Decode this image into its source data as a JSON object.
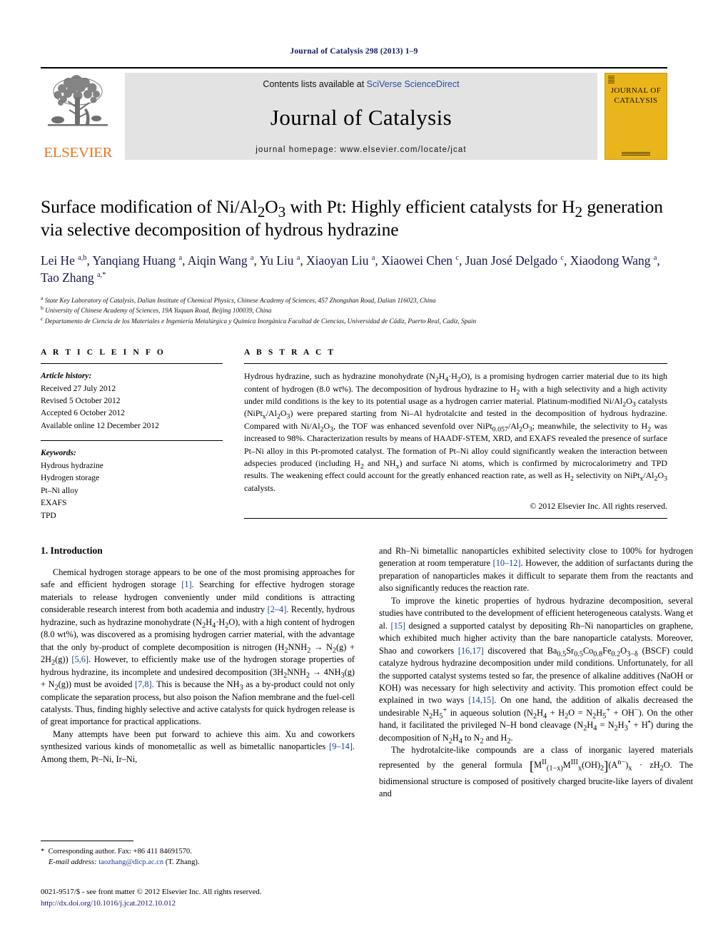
{
  "running_head": "Journal of Catalysis 298 (2013) 1–9",
  "masthead": {
    "contents_prefix": "Contents lists available at ",
    "contents_link": "SciVerse ScienceDirect",
    "journal_name": "Journal of Catalysis",
    "homepage": "journal homepage: www.elsevier.com/locate/jcat",
    "publisher_wordmark": "ELSEVIER",
    "cover_title_line1": "JOURNAL OF",
    "cover_title_line2": "CATALYSIS"
  },
  "article": {
    "title": "Surface modification of Ni/Al2O3 with Pt: Highly efficient catalysts for H2 generation via selective decomposition of hydrous hydrazine",
    "authors_plain": "Lei He a,b, Yanqiang Huang a, Aiqin Wang a, Yu Liu a, Xiaoyan Liu a, Xiaowei Chen c, Juan José Delgado c, Xiaodong Wang a, Tao Zhang a,*",
    "affiliations": [
      "State Key Laboratory of Catalysis, Dalian Institute of Chemical Physics, Chinese Academy of Sciences, 457 Zhongshan Road, Dalian 116023, China",
      "University of Chinese Academy of Sciences, 19A Yuquan Road, Beijing 100039, China",
      "Departamento de Ciencia de los Materiales e Ingeniería Metalúrgica y Química Inorgánica Facultad de Ciencias, Universidad de Cádiz, Puerto Real, Cadiz, Spain"
    ]
  },
  "info": {
    "heading": "A R T I C L E    I N F O",
    "history_label": "Article history:",
    "history": [
      "Received 27 July 2012",
      "Revised 5 October 2012",
      "Accepted 6 October 2012",
      "Available online 12 December 2012"
    ],
    "keywords_label": "Keywords:",
    "keywords": [
      "Hydrous hydrazine",
      "Hydrogen storage",
      "Pt–Ni alloy",
      "EXAFS",
      "TPD"
    ]
  },
  "abstract": {
    "heading": "A B S T R A C T",
    "copyright": "© 2012 Elsevier Inc. All rights reserved."
  },
  "body": {
    "section1_title": "1. Introduction"
  },
  "footnote": {
    "corresponding": "Corresponding author. Fax: +86 411 84691570.",
    "email_label": "E-mail address:",
    "email": "taozhang@dicp.ac.cn",
    "email_suffix": "(T. Zhang)."
  },
  "issn": {
    "line1": "0021-9517/$ - see front matter © 2012 Elsevier Inc. All rights reserved.",
    "doi": "http://dx.doi.org/10.1016/j.jcat.2012.10.012"
  },
  "colors": {
    "link_blue": "#2b4b9b",
    "cite_blue": "#1c3f94",
    "author_navy": "#17174f",
    "elsevier_orange": "#e87722",
    "cover_yellow": "#e9b51b",
    "masthead_gray": "#e3e3e3"
  }
}
